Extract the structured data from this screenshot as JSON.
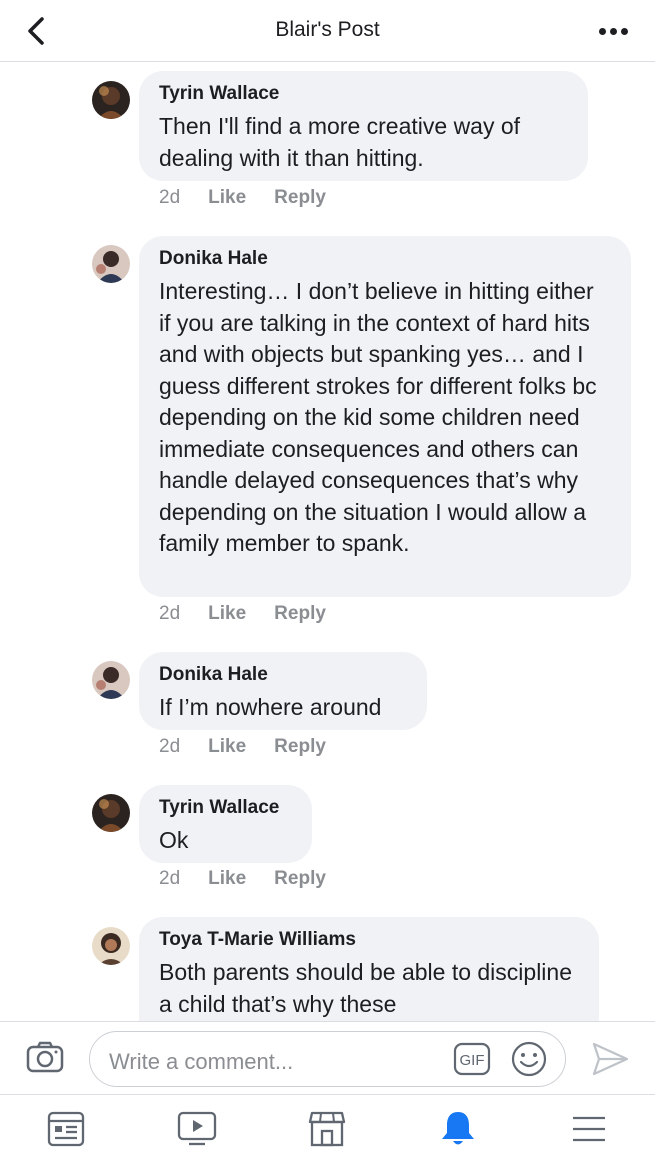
{
  "header": {
    "title": "Blair's Post",
    "back_icon": "chevron-left-icon",
    "more_icon": "more-horizontal-icon"
  },
  "comments": [
    {
      "author": "Tyrin Wallace",
      "text": "Then I'll find a  more creative way of dealing with it than hitting.",
      "time": "2d",
      "like": "Like",
      "reply": "Reply"
    },
    {
      "author": "Donika Hale",
      "text": "Interesting… I don’t believe in hitting either if you are talking in the context of hard hits and with objects but spanking yes… and I guess different strokes for different folks bc depending on the kid some children need immediate consequences and others can handle delayed consequences that’s why depending on the situation I would allow a family member to spank.",
      "time": "2d",
      "like": "Like",
      "reply": "Reply"
    },
    {
      "author": "Donika Hale",
      "text": "If I’m nowhere around",
      "time": "2d",
      "like": "Like",
      "reply": "Reply"
    },
    {
      "author": "Tyrin Wallace",
      "text": "Ok",
      "time": "2d",
      "like": "Like",
      "reply": "Reply"
    },
    {
      "author": "Toya T-Marie Williams",
      "text": "Both parents should be able to discipline a child that’s why these",
      "time": "",
      "like": "",
      "reply": ""
    }
  ],
  "composer": {
    "placeholder": "Write a comment...",
    "camera_icon": "camera-icon",
    "gif_label": "GIF",
    "emoji_icon": "emoji-icon",
    "send_icon": "send-icon"
  },
  "tabbar": {
    "items": [
      "news-feed-icon",
      "watch-icon",
      "marketplace-icon",
      "notifications-icon",
      "menu-icon"
    ],
    "active_color": "#1877f2"
  }
}
